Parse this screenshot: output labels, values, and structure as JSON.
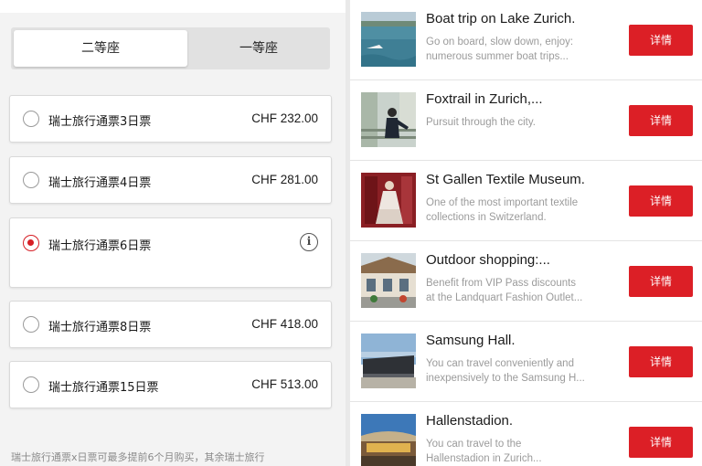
{
  "class_selector": {
    "second_class": "二等座",
    "first_class": "一等座",
    "selected": "二等座"
  },
  "tickets": [
    {
      "name": "瑞士旅行通票3日票",
      "price": "CHF 232.00",
      "selected": false
    },
    {
      "name": "瑞士旅行通票4日票",
      "price": "CHF 281.00",
      "selected": false
    },
    {
      "name": "瑞士旅行通票6日票",
      "price": "",
      "selected": true,
      "icon": "info-icon"
    },
    {
      "name": "瑞士旅行通票8日票",
      "price": "CHF 418.00",
      "selected": false
    },
    {
      "name": "瑞士旅行通票15日票",
      "price": "CHF 513.00",
      "selected": false
    }
  ],
  "footnote": "瑞士旅行通票x日票可最多提前6个月购买，其余瑞士旅行",
  "experiences": [
    {
      "title": "Boat trip on Lake Zurich.",
      "desc1": "Go on board, slow down, enjoy:",
      "desc2": "numerous summer boat trips...",
      "button": "详情"
    },
    {
      "title": "Foxtrail in Zurich,...",
      "desc1": "Pursuit through the city.",
      "desc2": "",
      "button": "详情"
    },
    {
      "title": "St Gallen Textile Museum.",
      "desc1": "One of the most important textile",
      "desc2": "collections in Switzerland.",
      "button": "详情"
    },
    {
      "title": "Outdoor shopping:...",
      "desc1": "Benefit from VIP Pass discounts",
      "desc2": "at the Landquart Fashion Outlet...",
      "button": "详情"
    },
    {
      "title": "Samsung Hall.",
      "desc1": "You can travel conveniently and",
      "desc2": "inexpensively to the Samsung H...",
      "button": "详情"
    },
    {
      "title": "Hallenstadion.",
      "desc1": "You can travel to the",
      "desc2": "Hallenstadion in Zurich...",
      "button": "详情"
    }
  ],
  "colors": {
    "accent": "#dc1f26",
    "radio_selected": "#d61f26"
  }
}
